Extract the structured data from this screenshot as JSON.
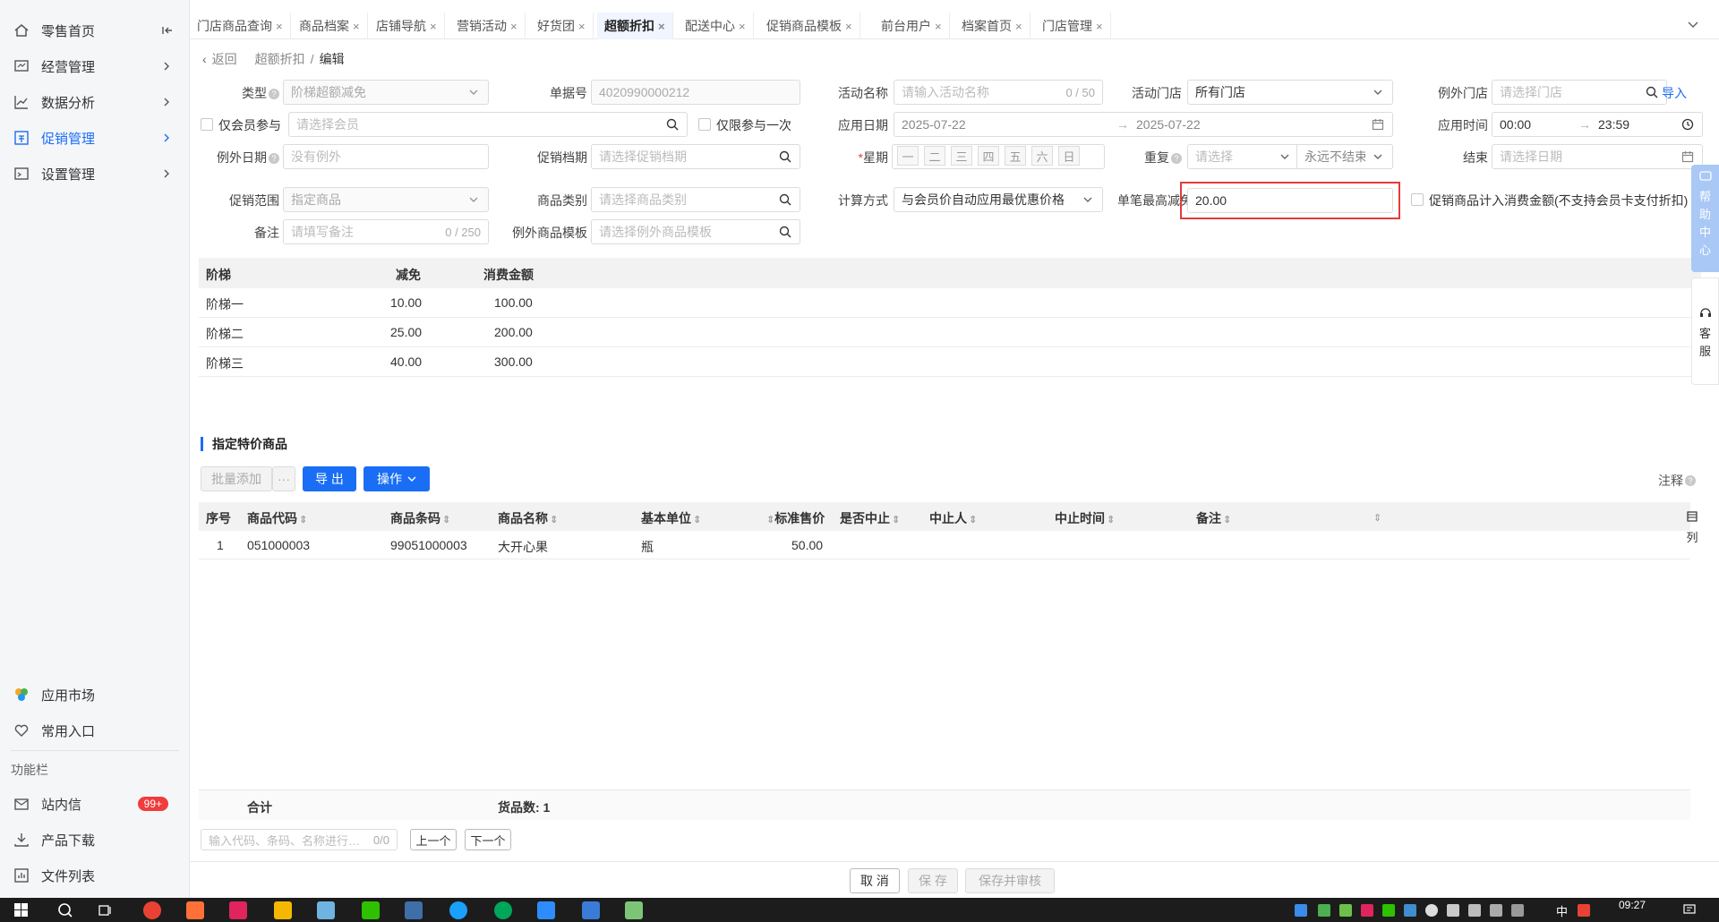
{
  "sidebar": {
    "items": [
      {
        "label": "零售首页",
        "icon": "home-icon"
      },
      {
        "label": "经营管理",
        "icon": "monitor-icon"
      },
      {
        "label": "数据分析",
        "icon": "chart-line-icon"
      },
      {
        "label": "促销管理",
        "icon": "promotion-icon"
      },
      {
        "label": "设置管理",
        "icon": "settings-folder-icon"
      }
    ],
    "bottom": {
      "app_market": "应用市场",
      "common_entry": "常用入口",
      "section_label": "功能栏",
      "messages": "站内信",
      "messages_badge": "99+",
      "downloads": "产品下载",
      "files": "文件列表"
    }
  },
  "tabs": [
    {
      "label": "门店商品查询"
    },
    {
      "label": "商品档案"
    },
    {
      "label": "店铺导航"
    },
    {
      "label": "营销活动"
    },
    {
      "label": "好货团"
    },
    {
      "label": "超额折扣",
      "active": true
    },
    {
      "label": "配送中心"
    },
    {
      "label": "促销商品模板"
    },
    {
      "label": "前台用户"
    },
    {
      "label": "档案首页"
    },
    {
      "label": "门店管理"
    }
  ],
  "breadcrumb": {
    "back": "返回",
    "parent": "超额折扣",
    "sep": "/",
    "current": "编辑"
  },
  "form": {
    "type_label": "类型",
    "type_value": "阶梯超额减免",
    "doc_no_label": "单据号",
    "doc_no_value": "4020990000212",
    "activity_name_label": "活动名称",
    "activity_name_placeholder": "请输入活动名称",
    "activity_name_count": "0 / 50",
    "activity_store_label": "活动门店",
    "activity_store_value": "所有门店",
    "exclude_store_label": "例外门店",
    "exclude_store_placeholder": "请选择门店",
    "import_link": "导入",
    "member_only_label": "仅会员参与",
    "member_placeholder": "请选择会员",
    "once_only_label": "仅限参与一次",
    "apply_date_label": "应用日期",
    "apply_date_start": "2025-07-22",
    "apply_date_arrow": "→",
    "apply_date_end": "2025-07-22",
    "apply_time_label": "应用时间",
    "apply_time_start": "00:00",
    "apply_time_arrow": "→",
    "apply_time_end": "23:59",
    "exclude_date_label": "例外日期",
    "exclude_date_placeholder": "没有例外",
    "promo_period_label": "促销档期",
    "promo_period_placeholder": "请选择促销档期",
    "week_req": "*",
    "week_label": "星期",
    "week_days": [
      "一",
      "二",
      "三",
      "四",
      "五",
      "六",
      "日"
    ],
    "repeat_label": "重复",
    "repeat_placeholder": "请选择",
    "repeat_end_value": "永远不结束",
    "end_label": "结束",
    "end_placeholder": "请选择日期",
    "scope_label": "促销范围",
    "scope_value": "指定商品",
    "category_label": "商品类别",
    "category_placeholder": "请选择商品类别",
    "calc_label": "计算方式",
    "calc_value": "与会员价自动应用最优惠价格",
    "max_discount_label": "单笔最高减免",
    "max_discount_value": "20.00",
    "count_consume_label": "促销商品计入消费金额(不支持会员卡支付折扣)",
    "remark_label": "备注",
    "remark_placeholder": "请填写备注",
    "remark_count": "0 / 250",
    "exclude_template_label": "例外商品模板",
    "exclude_template_placeholder": "请选择例外商品模板"
  },
  "ladder": {
    "headers": [
      "阶梯",
      "减免",
      "消费金额"
    ],
    "rows": [
      [
        "阶梯一",
        "10.00",
        "100.00"
      ],
      [
        "阶梯二",
        "25.00",
        "200.00"
      ],
      [
        "阶梯三",
        "40.00",
        "300.00"
      ]
    ]
  },
  "products": {
    "title": "指定特价商品",
    "batch_add": "批量添加",
    "more": "···",
    "export": "导 出",
    "operate": "操作",
    "note": "注释",
    "columns_btn": "列",
    "headers": [
      "序号",
      "商品代码",
      "商品条码",
      "商品名称",
      "基本单位",
      "标准售价",
      "是否中止",
      "中止人",
      "中止时间",
      "备注"
    ],
    "rows": [
      [
        "1",
        "051000003",
        "99051000003",
        "大开心果",
        "瓶",
        "50.00",
        "",
        "",
        "",
        ""
      ]
    ],
    "footer_total": "合计",
    "footer_count": "货品数: 1",
    "search_placeholder": "输入代码、条码、名称进行…",
    "search_count": "0/0",
    "prev": "上一个",
    "next": "下一个"
  },
  "actions": {
    "cancel": "取 消",
    "save": "保 存",
    "save_audit": "保存并审核"
  },
  "floating": {
    "help": [
      "帮",
      "助",
      "中",
      "心"
    ],
    "service": [
      "客",
      "服"
    ]
  },
  "taskbar": {
    "time": "09:27",
    "ime": "中"
  },
  "colors": {
    "accent": "#1a6ef5",
    "highlight": "#e23b3b",
    "badge": "#f03c3c"
  }
}
